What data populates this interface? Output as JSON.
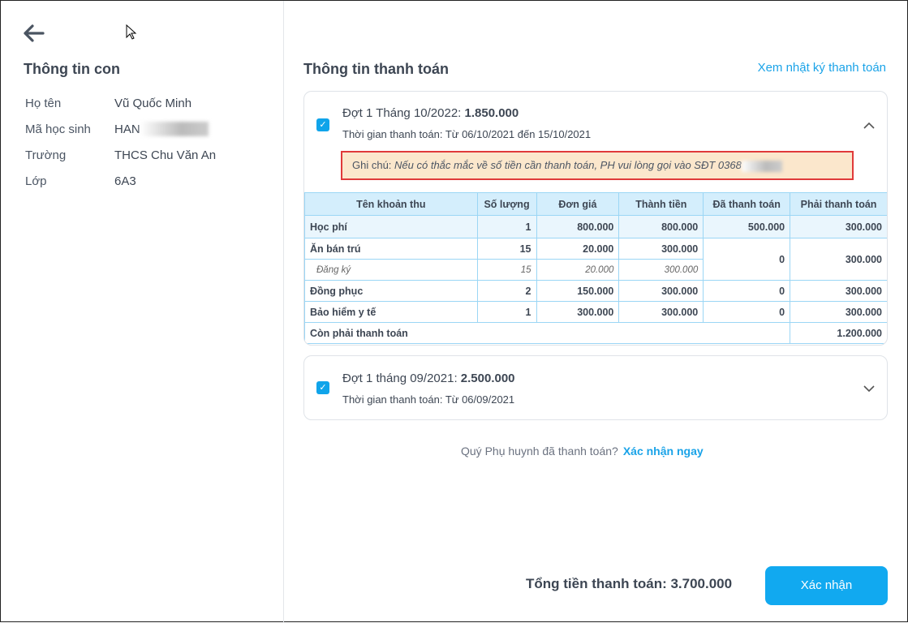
{
  "left": {
    "title": "Thông tin con",
    "fields": [
      {
        "label": "Họ tên",
        "value": "Vũ Quốc Minh"
      },
      {
        "label": "Mã học sinh",
        "value": "HAN"
      },
      {
        "label": "Trường",
        "value": "THCS Chu Văn An"
      },
      {
        "label": "Lớp",
        "value": "6A3"
      }
    ]
  },
  "main": {
    "title": "Thông tin thanh toán",
    "history_link": "Xem nhật ký thanh toán",
    "periods": [
      {
        "title": "Đợt 1 Tháng 10/2022: ",
        "amount": "1.850.000",
        "time": "Thời gian thanh toán: Từ 06/10/2021 đến 15/10/2021",
        "note_label": "Ghi chú: ",
        "note": "Nếu có thắc mắc về số tiền cần thanh toán, PH vui lòng gọi vào SĐT 0368"
      },
      {
        "title": "Đợt 1 tháng 09/2021: ",
        "amount": "2.500.000",
        "time": "Thời gian thanh toán: Từ 06/09/2021"
      }
    ],
    "table": {
      "headers": [
        "Tên khoản thu",
        "Số lượng",
        "Đơn giá",
        "Thành tiền",
        "Đã thanh toán",
        "Phải thanh toán"
      ],
      "rows": [
        [
          "Học phí",
          "1",
          "800.000",
          "800.000",
          "500.000",
          "300.000"
        ],
        [
          "Ăn bán trú",
          "15",
          "20.000",
          "300.000",
          "0",
          "300.000"
        ],
        [
          "Đăng ký",
          "15",
          "20.000",
          "300.000"
        ],
        [
          "Đồng phục",
          "2",
          "150.000",
          "300.000",
          "0",
          "300.000"
        ],
        [
          "Bảo hiểm y tế",
          "1",
          "300.000",
          "300.000",
          "0",
          "300.000"
        ]
      ],
      "remaining_label": "Còn phải thanh toán",
      "remaining": "1.200.000"
    },
    "confirm_question": "Quý Phụ huynh đã thanh toán?",
    "confirm_link": "Xác nhận ngay"
  },
  "footer": {
    "total": "Tổng tiền thanh toán: 3.700.000",
    "confirm": "Xác nhận"
  }
}
